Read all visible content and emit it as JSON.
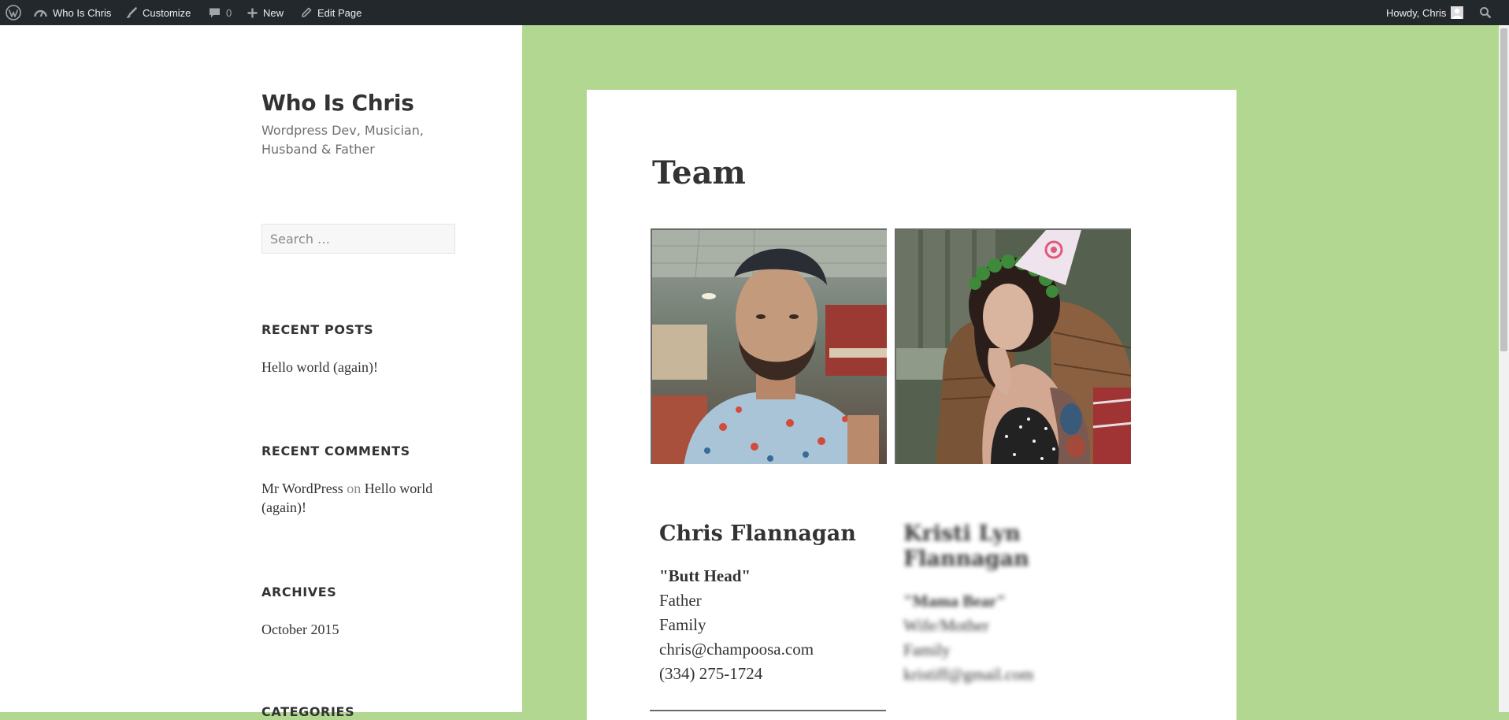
{
  "admin_bar": {
    "site_name": "Who Is Chris",
    "customize": "Customize",
    "comments_count": "0",
    "new": "New",
    "edit_page": "Edit Page",
    "howdy": "Howdy, Chris"
  },
  "sidebar": {
    "site_title": "Who Is Chris",
    "tagline": "Wordpress Dev, Musician, Husband & Father",
    "search_placeholder": "Search …",
    "recent_posts": {
      "title": "RECENT POSTS",
      "items": [
        "Hello world (again)!"
      ]
    },
    "recent_comments": {
      "title": "RECENT COMMENTS",
      "author": "Mr WordPress",
      "on": "on",
      "post": "Hello world (again)!"
    },
    "archives": {
      "title": "ARCHIVES",
      "items": [
        "October 2015"
      ]
    },
    "categories": {
      "title": "CATEGORIES"
    }
  },
  "page": {
    "title": "Team",
    "members": [
      {
        "name": "Chris Flannagan",
        "nickname": "\"Butt Head\"",
        "role": "Father",
        "group": "Family",
        "email": "chris@champoosa.com",
        "phone": "(334) 275-1724"
      },
      {
        "name": "Kristi Lyn Flannagan",
        "nickname": "\"Mama Bear\"",
        "role": "Wife/Mother",
        "group": "Family",
        "email": "kristiff@gmail.com"
      }
    ]
  },
  "colors": {
    "admin_bar": "#23282d",
    "page_background": "#b1d791",
    "text": "#333333"
  }
}
